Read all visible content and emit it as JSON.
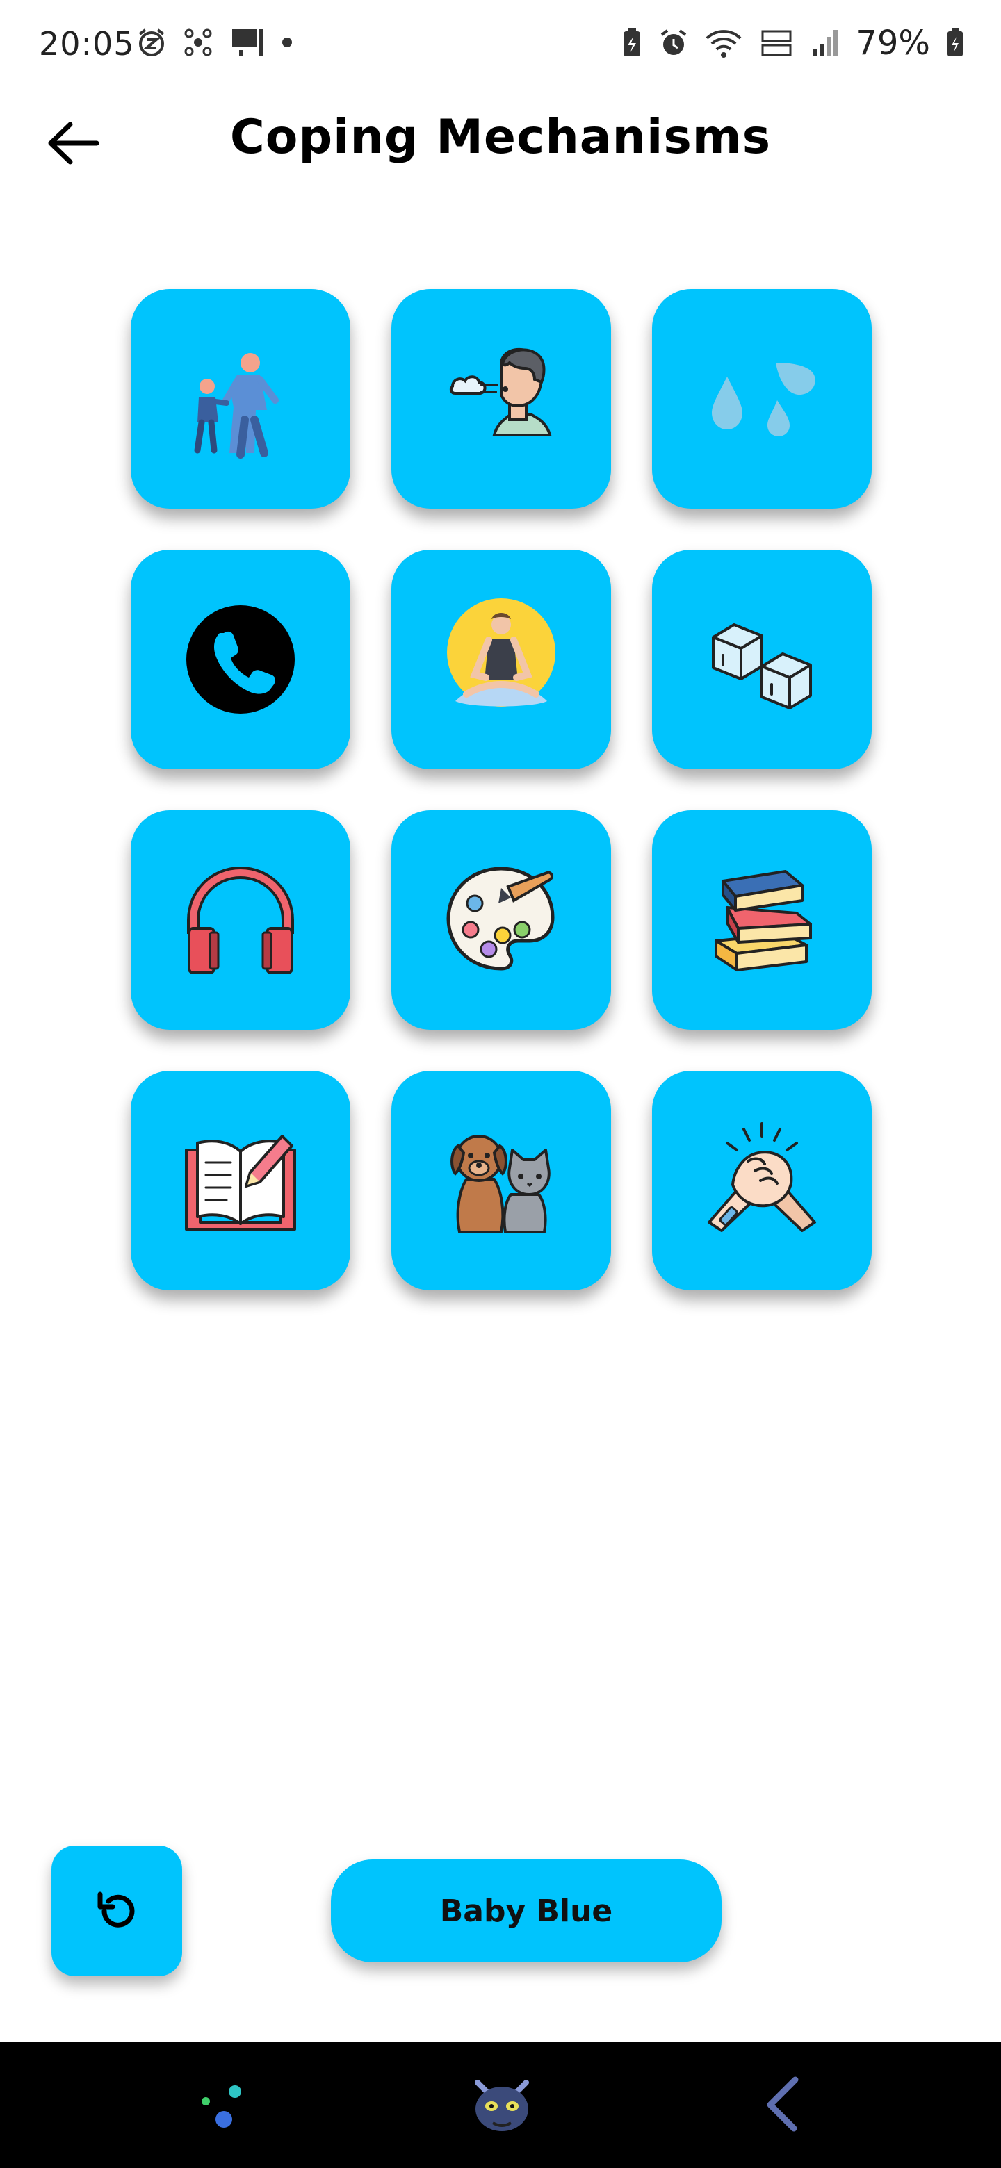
{
  "status_bar": {
    "time": "20:05",
    "battery": "79%"
  },
  "header": {
    "title": "Coping Mechanisms"
  },
  "tiles": [
    {
      "icon": "walking-together-icon"
    },
    {
      "icon": "breathing-icon"
    },
    {
      "icon": "water-drops-icon"
    },
    {
      "icon": "phone-call-icon"
    },
    {
      "icon": "meditation-icon"
    },
    {
      "icon": "ice-cubes-icon"
    },
    {
      "icon": "headphones-icon"
    },
    {
      "icon": "paint-palette-icon"
    },
    {
      "icon": "books-icon"
    },
    {
      "icon": "journal-icon"
    },
    {
      "icon": "pets-icon"
    },
    {
      "icon": "hand-clasp-icon"
    }
  ],
  "footer": {
    "theme_label": "Baby Blue"
  },
  "colors": {
    "tile": "#00c4fd",
    "background": "#ffffff",
    "nav_bar": "#000000"
  }
}
